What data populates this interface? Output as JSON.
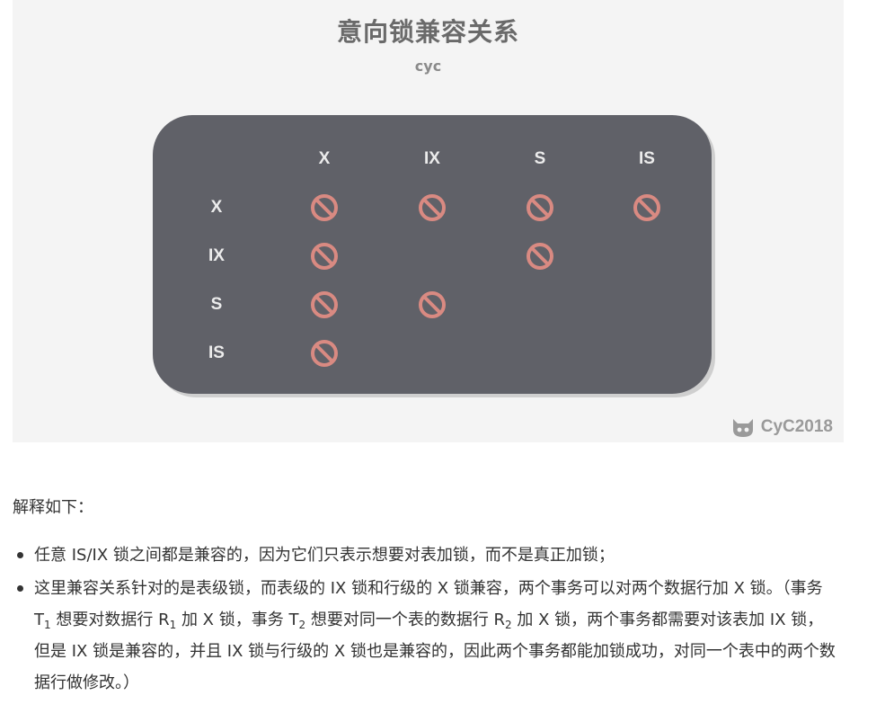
{
  "figure": {
    "title": "意向锁兼容关系",
    "subtitle": "cyc",
    "columns": [
      "X",
      "IX",
      "S",
      "IS"
    ],
    "rows": [
      "X",
      "IX",
      "S",
      "IS"
    ],
    "conflicts": [
      [
        true,
        true,
        true,
        true
      ],
      [
        true,
        false,
        true,
        false
      ],
      [
        true,
        true,
        false,
        false
      ],
      [
        true,
        false,
        false,
        false
      ]
    ],
    "conflict_icon": "prohibited-icon",
    "conflict_color": "#d98a82",
    "watermark": "CyC2018"
  },
  "explanation": {
    "heading": "解释如下：",
    "bullet1": "任意 IS/IX 锁之间都是兼容的，因为它们只表示想要对表加锁，而不是真正加锁；",
    "bullet2": {
      "p1": "这里兼容关系针对的是表级锁，而表级的 IX 锁和行级的 X 锁兼容，两个事务可以对两个数据行加 X 锁。（事务 T",
      "s1": "1",
      "p2": " 想要对数据行 R",
      "s2": "1",
      "p3": " 加 X 锁，事务 T",
      "s3": "2",
      "p4": " 想要对同一个表的数据行 R",
      "s4": "2",
      "p5": " 加 X 锁，两个事务都需要对该表加 IX 锁，但是 IX 锁是兼容的，并且 IX 锁与行级的 X 锁也是兼容的，因此两个事务都能加锁成功，对同一个表中的两个数据行做修改。）"
    }
  }
}
